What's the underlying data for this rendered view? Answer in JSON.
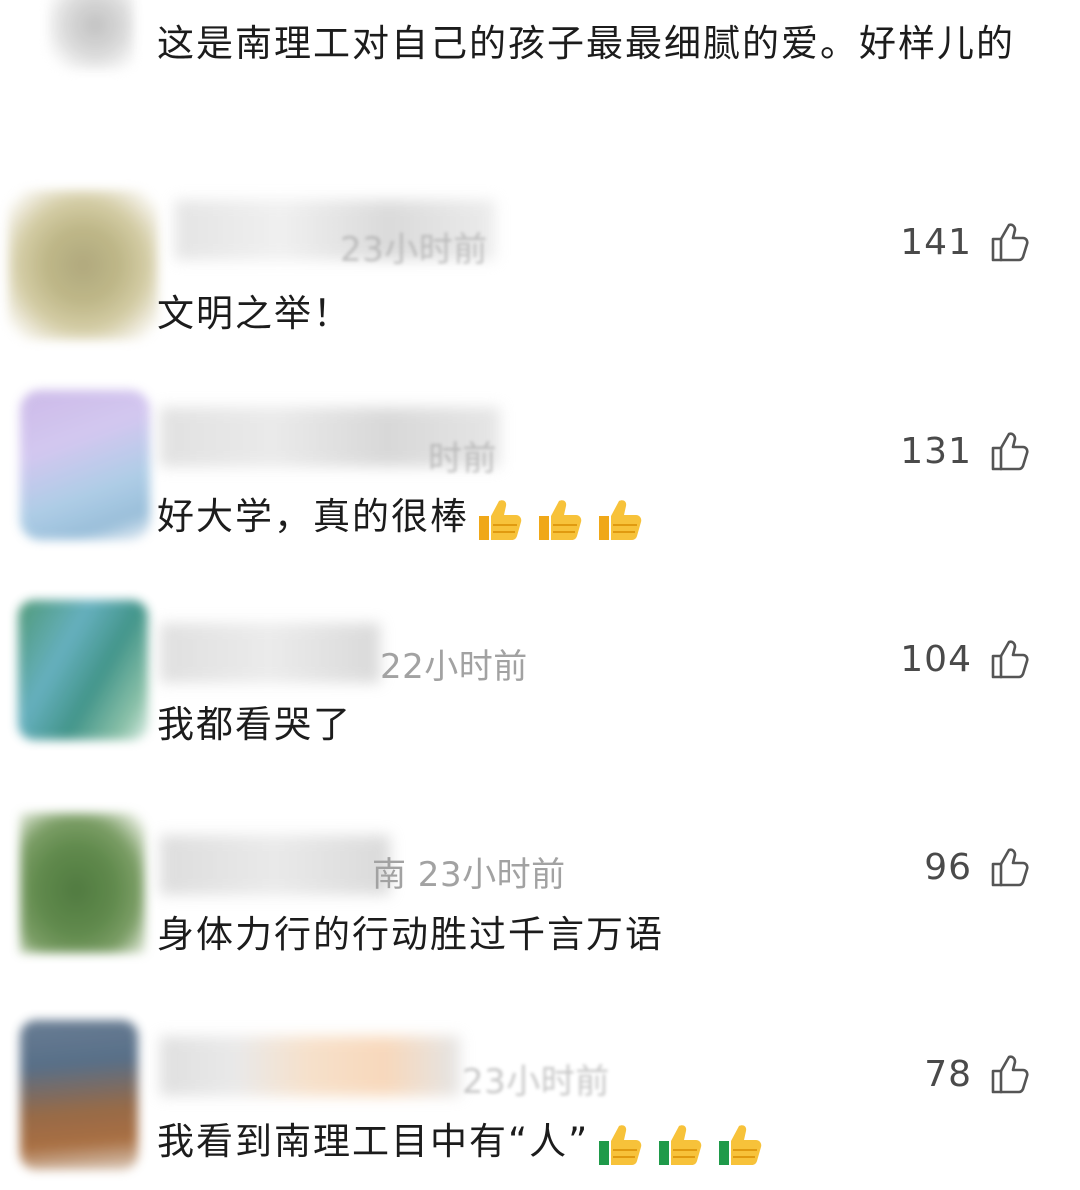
{
  "first_comment": {
    "text": "这是南理工对自己的孩子最最细腻的爱。好样儿的"
  },
  "comments": [
    {
      "time": "23小时前",
      "likes": "141",
      "text": "文明之举！"
    },
    {
      "time": "时前",
      "likes": "131",
      "text": "好大学，真的很棒",
      "emoji": "thumbs-up",
      "emoji_count": 3
    },
    {
      "time": "22小时前",
      "likes": "104",
      "text": "我都看哭了"
    },
    {
      "time": "南 23小时前",
      "likes": "96",
      "text": "身体力行的行动胜过千言万语"
    },
    {
      "time": "23小时前",
      "likes": "78",
      "text": "我看到南理工目中有“人”",
      "emoji": "thumbs-up",
      "emoji_count": 3
    }
  ],
  "colors": {
    "text": "#1c1c1c",
    "meta": "#a2a2a2",
    "likes": "#4a4a4a",
    "emoji": "#f5b820"
  }
}
